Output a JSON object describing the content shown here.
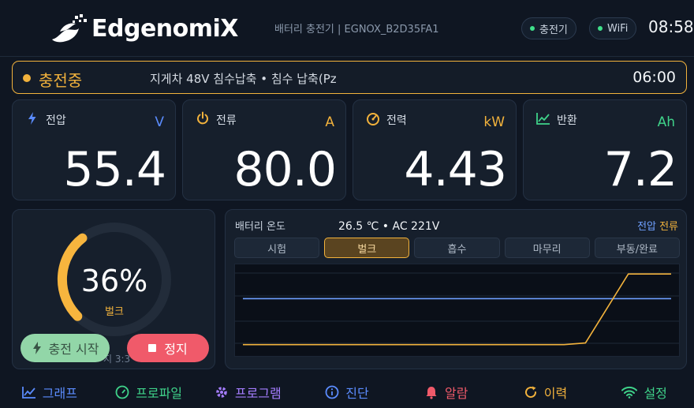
{
  "header": {
    "brand": "EdgenomiX",
    "subtitle": "배터리 충전기  |  EGNOX_B2D35FA1",
    "pill_charger": "충전기",
    "pill_wifi": "WiFi",
    "clock": "08:58"
  },
  "status": {
    "label": "충전중",
    "description": "지게차 48V 침수납축 • 침수 납축(Pz",
    "time": "06:00"
  },
  "metrics": [
    {
      "label": "전압",
      "unit": "V",
      "value": "55.4",
      "icon": "bolt-icon",
      "color": "#5b8cff"
    },
    {
      "label": "전류",
      "unit": "A",
      "value": "80.0",
      "icon": "power-icon",
      "color": "#f2b23c"
    },
    {
      "label": "전력",
      "unit": "kW",
      "value": "4.43",
      "icon": "gauge-icon",
      "color": "#f2b23c"
    },
    {
      "label": "반환",
      "unit": "Ah",
      "value": "7.2",
      "icon": "trend-icon",
      "color": "#3fd38a"
    }
  ],
  "gauge": {
    "percent": 36,
    "percent_label": "36%",
    "mode": "벌크",
    "hint": "지 3:3",
    "start_label": "충전 시작",
    "stop_label": "정지"
  },
  "chart_panel": {
    "title": "배터리 온도",
    "temp_ac": "26.5 ℃ • AC 221V",
    "legend_voltage": "전압",
    "legend_current": "전류",
    "tabs": [
      "시험",
      "벌크",
      "흡수",
      "마무리",
      "부동/완료"
    ],
    "active_tab": 1
  },
  "chart_data": {
    "type": "line",
    "x": [
      0,
      10,
      20,
      30,
      40,
      50,
      60,
      70,
      75,
      80,
      90,
      100
    ],
    "series": [
      {
        "name": "전압",
        "color": "#6fa0ff",
        "values": [
          0.64,
          0.64,
          0.64,
          0.64,
          0.64,
          0.64,
          0.64,
          0.64,
          0.64,
          0.64,
          0.64,
          0.64
        ]
      },
      {
        "name": "전류",
        "color": "#f2b23c",
        "values": [
          0.08,
          0.08,
          0.08,
          0.08,
          0.08,
          0.08,
          0.08,
          0.08,
          0.08,
          0.1,
          0.94,
          0.94
        ]
      }
    ]
  },
  "nav": [
    {
      "label": "그래프",
      "icon": "chart-icon",
      "color": "#5b8cff"
    },
    {
      "label": "프로파일",
      "icon": "speed-icon",
      "color": "#3fd38a"
    },
    {
      "label": "프로그램",
      "icon": "gear-icon",
      "color": "#a57dff"
    },
    {
      "label": "진단",
      "icon": "info-icon",
      "color": "#5b8cff"
    },
    {
      "label": "알람",
      "icon": "bell-icon",
      "color": "#f05a6a"
    },
    {
      "label": "이력",
      "icon": "history-icon",
      "color": "#f2b23c"
    },
    {
      "label": "설정",
      "icon": "wifi-icon",
      "color": "#3fd38a"
    }
  ]
}
